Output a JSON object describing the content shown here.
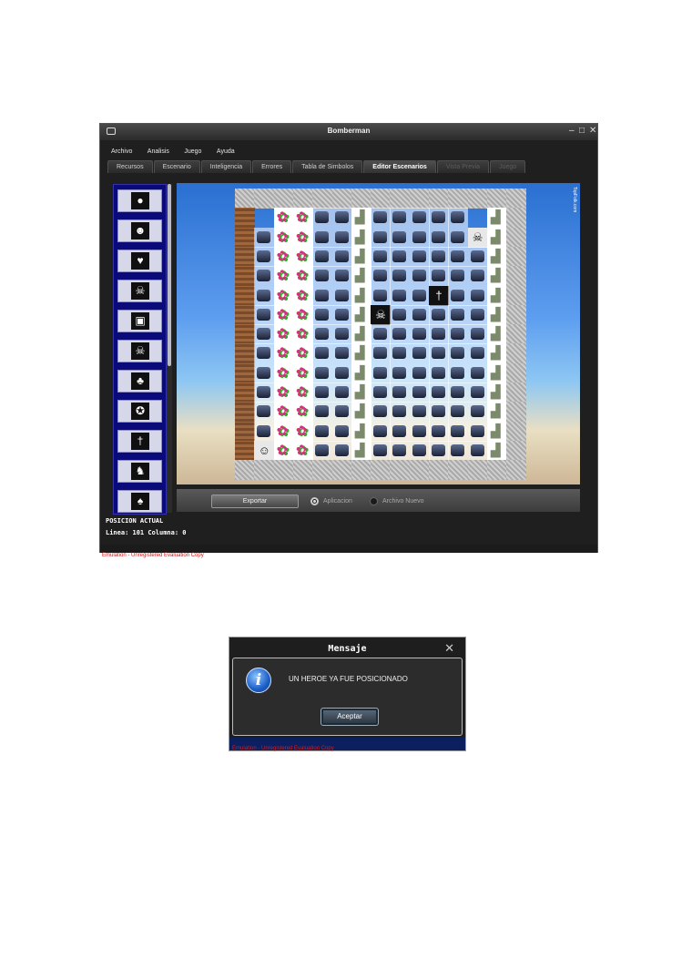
{
  "window": {
    "title": "Bomberman",
    "controls": [
      "minimize-icon",
      "maximize-icon",
      "close-icon"
    ]
  },
  "menu": [
    "Archivo",
    "Analisis",
    "Juego",
    "Ayuda"
  ],
  "tabs": [
    {
      "label": "Recursos",
      "state": "normal"
    },
    {
      "label": "Escenario",
      "state": "normal"
    },
    {
      "label": "Inteligencia",
      "state": "normal"
    },
    {
      "label": "Errores",
      "state": "normal"
    },
    {
      "label": "Tabla de Simbolos",
      "state": "normal"
    },
    {
      "label": "Editor Escenarios",
      "state": "active"
    },
    {
      "label": "Vista Previa",
      "state": "disabled"
    },
    {
      "label": "Juego",
      "state": "disabled"
    }
  ],
  "palette": [
    {
      "icon": "bomb-icon",
      "glyph": "●"
    },
    {
      "icon": "enemy-blob-icon",
      "glyph": "☻"
    },
    {
      "icon": "heart-icon",
      "glyph": "♥"
    },
    {
      "icon": "pirate-icon",
      "glyph": "☠"
    },
    {
      "icon": "treasure-chest-icon",
      "glyph": "▣"
    },
    {
      "icon": "skull-crossbones-icon",
      "glyph": "☠"
    },
    {
      "icon": "cactus-icon",
      "glyph": "♣"
    },
    {
      "icon": "tiger-icon",
      "glyph": "✪"
    },
    {
      "icon": "tiki-hammer-icon",
      "glyph": "†"
    },
    {
      "icon": "duck-icon",
      "glyph": "♞"
    },
    {
      "icon": "parrot-icon",
      "glyph": "♠"
    }
  ],
  "scene": {
    "watermark": "TopFolk.com",
    "rows": [
      "SSSSSSSSSSSSSSS",
      "BOFFBBCBBBBBOCS",
      "BBFFBBCBBBBBPCS",
      "BBFFBBCBBBBBBCS",
      "BBFFBBCBBBBBBCS",
      "BBFFBBCBBBTBBCS",
      "BBFFBBCXBBBBBCS",
      "BBFFBBCBBBBBBCS",
      "BBFFBBCBBBBBBCS",
      "BBFFBBCBBBBBBCS",
      "BBFFBBCBBBBBBCS",
      "BBFFBBCBBBBBBCS",
      "BBFFBBCBBBBBBCS",
      "BMFFBBCBBBBBBCS",
      "SSSSSSSSSSSSSSS"
    ]
  },
  "bottom": {
    "export_label": "Exportar",
    "radio_app": "Aplicacion",
    "radio_new": "Archivo Nuevo",
    "selected": "Aplicacion"
  },
  "position": {
    "title": "POSICION ACTUAL",
    "info": "Linea: 101 Columna: 0"
  },
  "window_footer": "Emulation - Unregistered Evaluation Copy",
  "dialog": {
    "title": "Mensaje",
    "message": "UN HEROE YA FUE POSICIONADO",
    "ok_label": "Aceptar",
    "footer": "Emulation - Unregistered Evaluation Copy"
  }
}
